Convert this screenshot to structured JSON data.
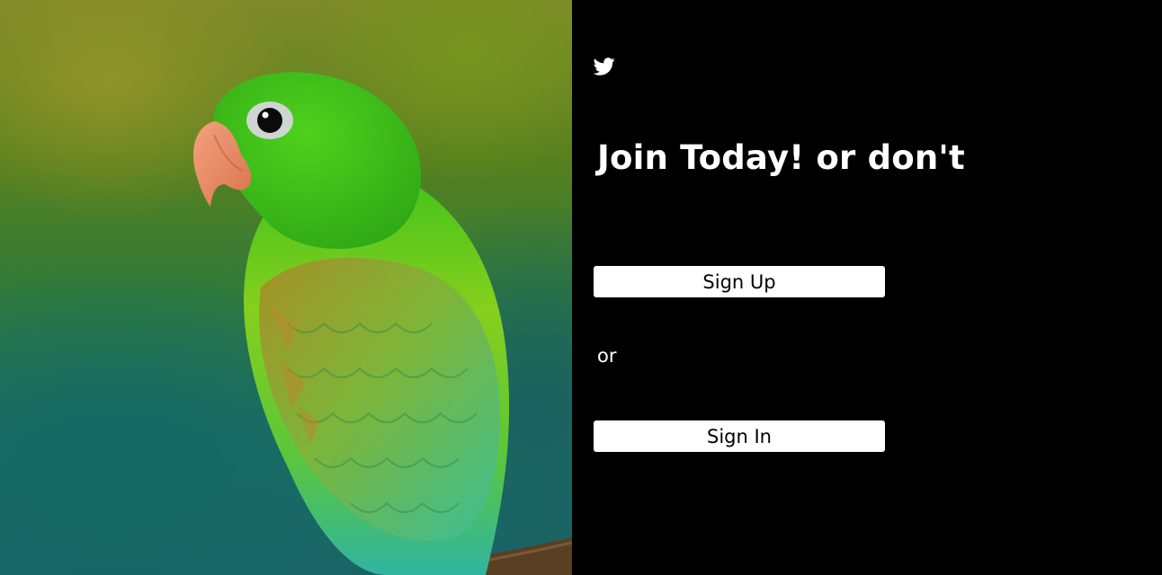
{
  "photo": {
    "subject": "green parakeet perched on a branch"
  },
  "panel": {
    "logo_icon": "twitter-bird-icon",
    "title": "Join Today! or don't",
    "signup_label": "Sign Up",
    "or_text": "or",
    "signin_label": "Sign In"
  },
  "colors": {
    "panel_background": "#000000",
    "button_background": "#ffffff",
    "button_text": "#000000",
    "text": "#ffffff"
  }
}
